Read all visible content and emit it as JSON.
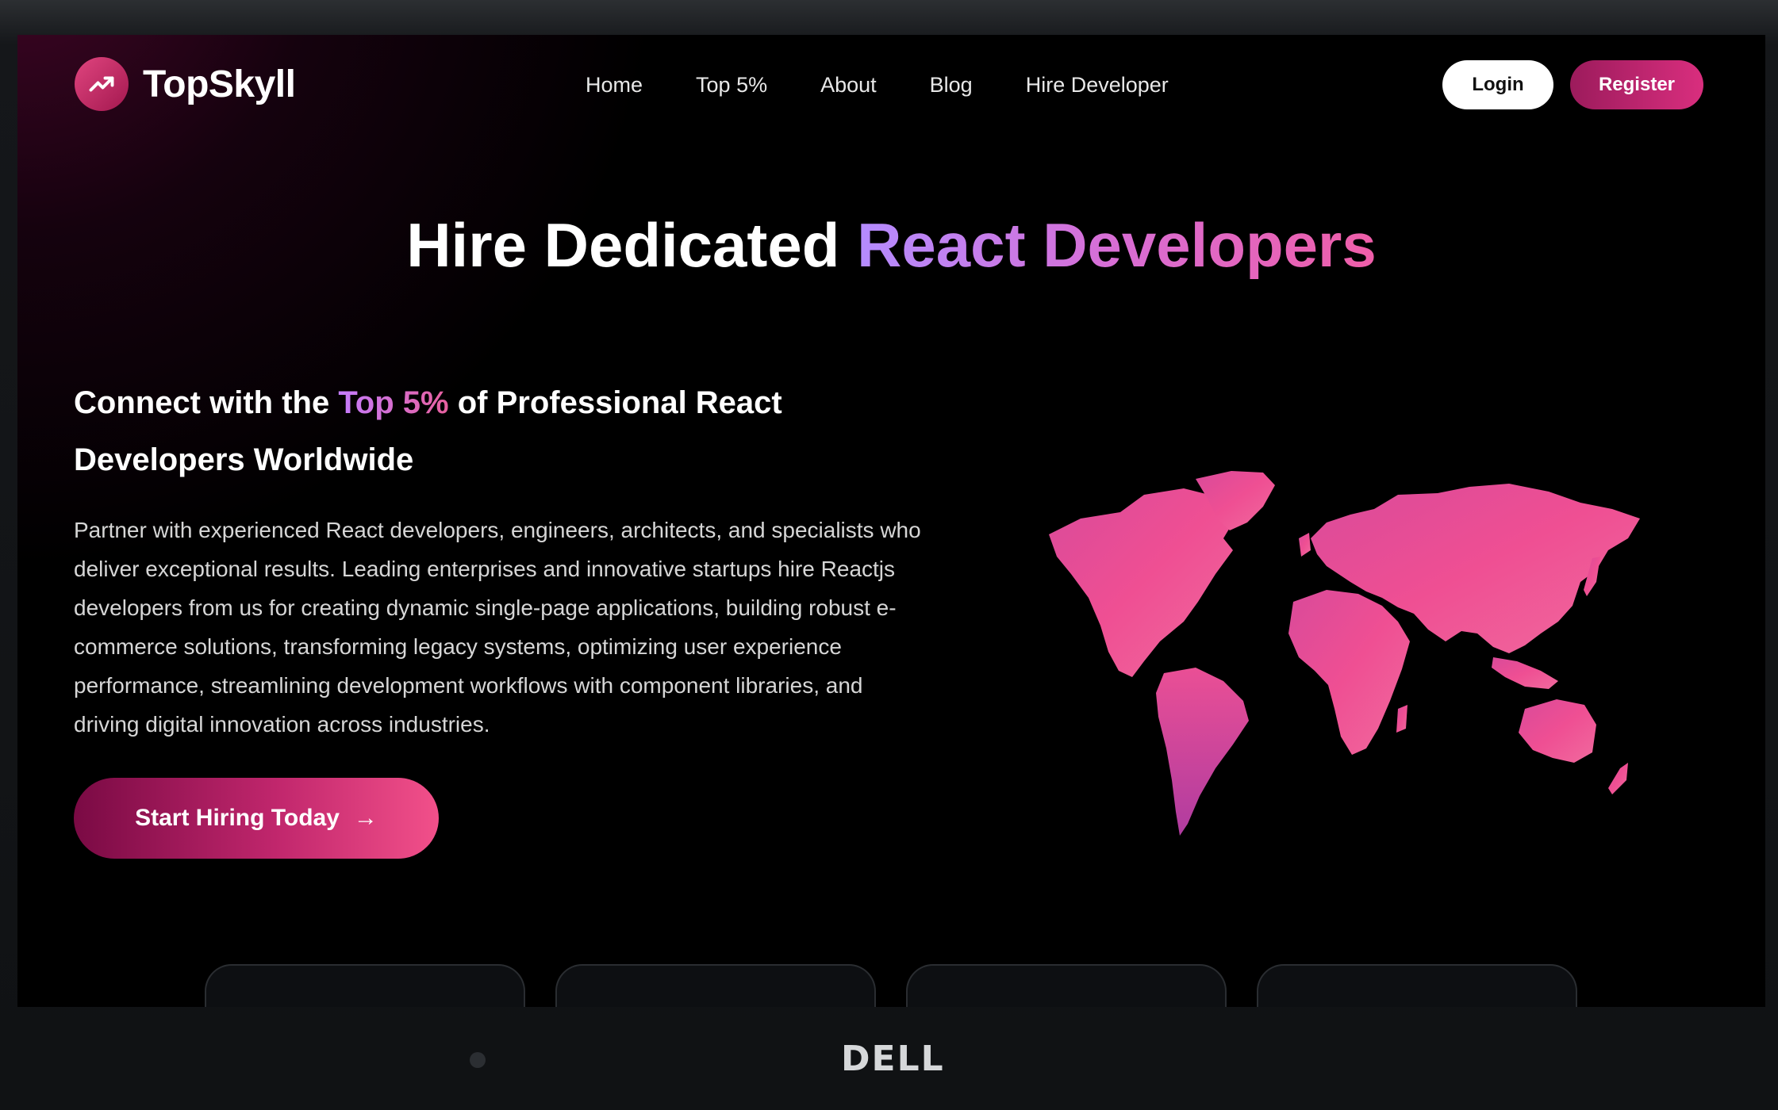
{
  "brand": {
    "name": "TopSkyll",
    "icon": "trending-up-icon"
  },
  "nav": {
    "items": [
      "Home",
      "Top 5%",
      "About",
      "Blog",
      "Hire Developer"
    ]
  },
  "auth": {
    "login_label": "Login",
    "register_label": "Register"
  },
  "hero": {
    "title_prefix": "Hire Dedicated",
    "title_highlight": "React Developers",
    "subheading_pre": "Connect with the",
    "subheading_highlight": "Top 5%",
    "subheading_post": "of Professional React Developers Worldwide",
    "description": "Partner with experienced React developers, engineers, architects, and specialists who deliver exceptional results. Leading enterprises and innovative startups hire Reactjs developers from us for creating dynamic single-page applications, building robust e-commerce solutions, transforming legacy systems, optimizing user experience performance, streamlining development workflows with component libraries, and driving digital innovation across industries.",
    "cta_label": "Start Hiring Today",
    "cta_icon": "arrow-right-icon"
  },
  "device": {
    "brand_logo": "DELL"
  },
  "colors": {
    "accent": "#d92e7e",
    "gradient_start": "#b48cff",
    "gradient_end": "#ef5ea8",
    "background": "#000000"
  }
}
